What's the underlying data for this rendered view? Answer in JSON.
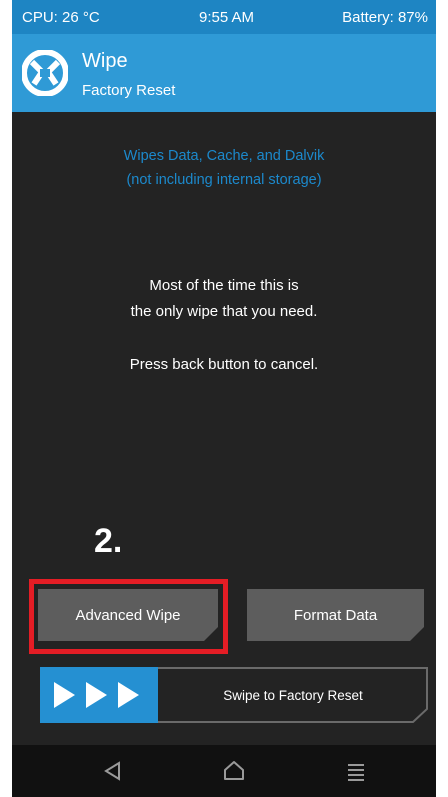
{
  "status_bar": {
    "cpu": "CPU: 26 °C",
    "time": "9:55 AM",
    "battery": "Battery: 87%"
  },
  "header": {
    "title": "Wipe",
    "subtitle": "Factory Reset",
    "logo_icon": "twrp-logo-icon"
  },
  "info": {
    "blue_line1": "Wipes Data, Cache, and Dalvik",
    "blue_line2": "(not including internal storage)",
    "white_line1": "Most of the time this is",
    "white_line2": "the only wipe that you need.",
    "white_line3": "Press back button to cancel."
  },
  "annotation": {
    "step_label": "2."
  },
  "buttons": {
    "advanced_wipe": "Advanced Wipe",
    "format_data": "Format Data"
  },
  "swipe": {
    "label": "Swipe to Factory Reset",
    "handle_icon": "triple-play-arrows-icon"
  },
  "navbar": {
    "back_icon": "back-triangle-icon",
    "home_icon": "home-icon",
    "menu_icon": "menu-lines-icon"
  },
  "colors": {
    "status_bar": "#1e85c3",
    "header": "#2f9ad6",
    "background": "#232323",
    "accent_text": "#1c89cc",
    "button": "#5d5d5d",
    "highlight": "#e41d25",
    "swipe_handle": "#2590d2"
  }
}
